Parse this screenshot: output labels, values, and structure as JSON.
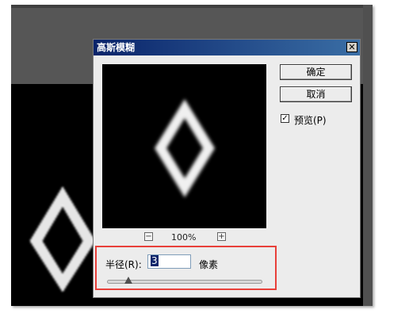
{
  "dialog": {
    "title": "高斯模糊",
    "close_symbol": "✕",
    "ok_label": "确定",
    "cancel_label": "取消",
    "preview_label": "预览(P)",
    "preview_checked": true,
    "zoom": {
      "minus_symbol": "−",
      "level": "100%",
      "plus_symbol": "+"
    },
    "radius": {
      "label": "半径(R):",
      "value": "3",
      "unit": "像素",
      "slider_level": 0.14
    }
  },
  "colors": {
    "titlebar_start": "#0a246a",
    "titlebar_end": "#3a6ea5",
    "highlight_box": "#e8403a",
    "canvas": "#000000"
  }
}
